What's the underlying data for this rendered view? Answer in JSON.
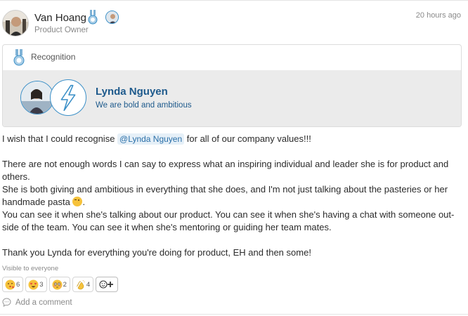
{
  "post": {
    "author_name": "Van Hoang",
    "author_role": "Product Owner",
    "timestamp": "20 hours ago"
  },
  "recognition": {
    "title": "Recognition",
    "recipient_name": "Lynda Nguyen",
    "value": "We are bold and ambitious"
  },
  "body": {
    "line1_pre": "I wish that I could recognise ",
    "mention": "@Lynda Nguyen",
    "line1_post": " for all of our company values!!!",
    "para2": "There are not enough words I can say to express what an inspiring individual and leader she is for product and others.",
    "para3_text": "She is both giving and ambitious in everything that she does, and I'm not just talking about the pasteries or her handmade pasta ",
    "para3_end": ".",
    "para4": "You can see it when she's talking about our product. You can see it when she's having a chat with someone out-side of the team. You can see it when she's mentoring or guiding her team mates.",
    "para5": "Thank you Lynda for everything you're doing for product, EH and then some!"
  },
  "footer": {
    "visibility": "Visible to everyone",
    "add_comment": "Add a comment"
  },
  "reactions": [
    {
      "icon": "kissing-heart-emoji",
      "count": "6",
      "color": "#f6c23b"
    },
    {
      "icon": "heart-eyes-emoji",
      "count": "3",
      "color": "#f6c23b"
    },
    {
      "icon": "flushed-face-emoji",
      "count": "2",
      "color": "#f6c23b"
    },
    {
      "icon": "clapping-hands-emoji",
      "count": "4",
      "color": "#f6c23b"
    }
  ],
  "colors": {
    "accent_blue": "#3a8fc7",
    "recipient_text": "#1e5a8c",
    "mention_bg": "#e6f0f8"
  }
}
